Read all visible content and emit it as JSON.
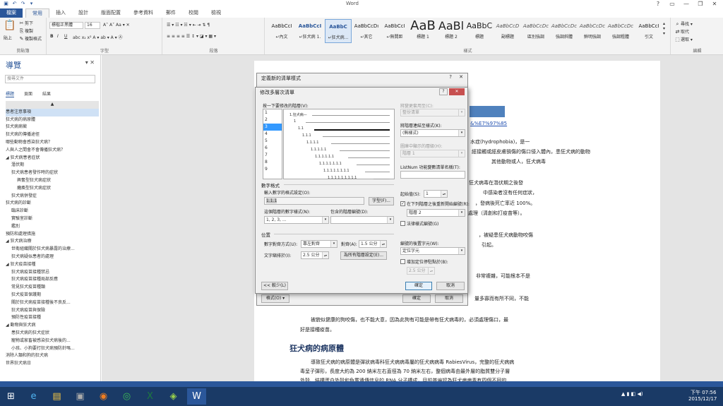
{
  "app": {
    "title": "Word",
    "qat": [
      "save-icon",
      "undo-icon",
      "redo-icon",
      "customize-icon"
    ],
    "window_controls": [
      "?",
      "▭",
      "—",
      "❐",
      "✕"
    ]
  },
  "tabs": [
    "檔案",
    "常用",
    "插入",
    "設計",
    "版面配置",
    "參考資料",
    "郵件",
    "校閱",
    "檢視"
  ],
  "ribbon": {
    "clipboard": {
      "label": "剪貼簿",
      "paste": "貼上",
      "cut": "剪下",
      "copy": "複製",
      "painter": "複製格式"
    },
    "font": {
      "label": "字型",
      "name": "標楷正黑體",
      "size": "16",
      "bold": "B",
      "italic": "I",
      "underline": "U"
    },
    "paragraph": {
      "label": "段落"
    },
    "styles": {
      "label": "樣式",
      "items": [
        {
          "sample": "AaBbCcI",
          "name": "↵內文"
        },
        {
          "sample": "AaBbCcI",
          "name": "↵狂犬病 1."
        },
        {
          "sample": "AaBbC",
          "name": "↵狂犬病..."
        },
        {
          "sample": "AaBbCcDı",
          "name": "↵其它"
        },
        {
          "sample": "AaBbCcI",
          "name": "↵無間距"
        },
        {
          "sample": "AaB",
          "name": "標題 1"
        },
        {
          "sample": "AaBl",
          "name": "標題 2"
        },
        {
          "sample": "AaBbC",
          "name": "標題"
        },
        {
          "sample": "AaBbCcD",
          "name": "副標題"
        },
        {
          "sample": "AaBbCcDc",
          "name": "區別強調"
        },
        {
          "sample": "AaBbCcDc",
          "name": "強調斜體"
        },
        {
          "sample": "AaBbCcDc",
          "name": "鮮明強調"
        },
        {
          "sample": "AaBbCcDc",
          "name": "強調粗體"
        },
        {
          "sample": "AaBbCcI",
          "name": "引文"
        }
      ]
    },
    "editing": {
      "label": "編輯",
      "find": "尋找",
      "replace": "取代",
      "select": "選取"
    }
  },
  "nav": {
    "title": "導覽",
    "search_placeholder": "搜尋文件",
    "tabs": [
      "標題",
      "頁面",
      "結果"
    ],
    "items": [
      "▲",
      "患者注意事項",
      "狂犬病的病原體",
      "狂犬病病徵",
      "狂犬病的傳播途徑",
      "哪些動物會感染狂犬病？",
      "人與人之間會不會傳播狂犬病？",
      "◢ 狂犬病患者症狀",
      "潛伏期",
      "狂犬病患者發作時的症狀",
      "興奮型狂犬病症狀",
      "癱瘓型狂犬病症狀",
      "狂犬病併發症",
      "狂犬病的診斷",
      "臨床診斷",
      "實驗室診斷",
      "鑑別",
      "預防和處理措施",
      "◢ 狂犬病治療",
      "世衛組織關於狂犬病暴露的治療...",
      "狂犬病疑似患者的處理",
      "◢ 狂犬疫苗接種",
      "狂犬病疫苗接種禁忌",
      "狂犬病疫苗接種局部反應",
      "常見狂犬疫苗種類",
      "狂犬疫苗保護期",
      "關於狂犬病疫苗接種後不良反...",
      "狂犬病疫苗與保險",
      "預防性疫苗接種",
      "◢ 動物與狂犬病",
      "患狂犬病的狂犬症狀",
      "寵物或家畜被感染狂犬病後的...",
      "小孩、小狗要打狂犬病預防針嗎...",
      "消除人類和狗的狂犬病",
      "世界狂犬病日"
    ]
  },
  "document": {
    "url": "&%E7%97%85",
    "lines": [
      {
        "t": "水症(hydrophobia)，是一"
      },
      {
        "t": "經接觸或經皮膚損傷的傷口侵入體內，患狂犬病的動物"
      },
      {
        "t": "其他動物或人，狂犬病毒"
      },
      {
        "t": "狂犬病毒在潛伏期之後發"
      },
      {
        "t": "中感染者沒有任何症狀，"
      },
      {
        "t": "，發病後死亡率近 100%。"
      },
      {
        "t": "處理（清創和打疫苗等）。"
      },
      {
        "t": "，被疑患狂犬病動物咬傷"
      },
      {
        "t": "引起。"
      },
      {
        "t": "非常複雜，可能根本不是"
      },
      {
        "t": "量多寡而有所不同，不能"
      }
    ],
    "para1": "被貌似健康的狗咬傷，也不能大意，因為此狗有可能是帶有狂犬病毒的，必須處理傷口，最",
    "para1b": "好是接種疫苗。",
    "heading": "狂犬病的病原體",
    "para2": "導致狂犬病的病原體是彈狀病毒科狂犬病病毒屬的狂犬病病毒 RabiesVirus，完整的狂犬病病",
    "para2b": "毒呈子彈形，長度大約為 200 納米左右直徑為 70 納米左右，整個病毒由最外層的脂質雙分子層",
    "para2c": "外殼、結構蛋白外殼和負載遺傳信息的 RNA 分子構成，目前普遍認為狂犬病病毒有四個不同的"
  },
  "outer_dialog": {
    "title": "定義新的清單樣式",
    "help": "?",
    "close": "✕",
    "ok": "確定",
    "cancel": "取消",
    "format": "格式(O) ▾"
  },
  "dialog": {
    "title": "修改多層次清單",
    "help": "?",
    "close": "✕",
    "level_label": "按一下要修改的階層(V):",
    "levels": [
      "1",
      "2",
      "3",
      "4",
      "5",
      "6",
      "7",
      "8",
      "9"
    ],
    "selected_level": "3",
    "preview_items": [
      "1.狂犬病—",
      "1",
      "1.1",
      "1.1.1",
      "1.1.1.1",
      "1.1.1.1.1",
      "1.1.1.1.1.1",
      "1.1.1.1.1.1.1",
      "1.1.1.1.1.1.1.1",
      "1.1.1.1.1.1.1.1.1"
    ],
    "apply_to_label": "將變更套用至(C):",
    "apply_to_value": "整份清單",
    "link_style_label": "將階層連結至樣式(K):",
    "link_style_value": "(無樣式)",
    "gallery_level_label": "圖庫中顯示的層級(H):",
    "gallery_level_value": "階層 1",
    "listnum_label": "ListNum 功能變數清單名稱(T):",
    "listnum_value": "",
    "number_format_section": "數字格式",
    "enter_format_label": "輸入數字的格式設定(O):",
    "enter_format_value": "1.1.1",
    "font_button": "字型(F)...",
    "number_style_label": "這個階層的數字樣式(N):",
    "number_style_value": "1, 2, 3, ...",
    "include_level_label": "包含的階層編號(D):",
    "include_level_value": "",
    "start_at_label": "起始值(S):",
    "start_at_value": "1",
    "restart_label": "在下列階層之後重新開始編號(R):",
    "restart_value": "階層 2",
    "legal_label": "法律樣式編號(G)",
    "position_section": "位置",
    "alignment_label": "數字對齊方式(U):",
    "alignment_value": "靠左對齊",
    "aligned_at_label": "對齊(A):",
    "aligned_at_value": "1.5 公分",
    "indent_label": "文字縮排於(I):",
    "indent_value": "2.5 公分",
    "set_all_button": "為所有階層設定(E)...",
    "follow_label": "編號的後置字元(W):",
    "follow_value": "定位字元",
    "tab_add_label": "增加定位停駐點於(B):",
    "tab_add_value": "2.5 公分",
    "less_button": "<< 較少(L)",
    "ok": "確定",
    "cancel": "取消"
  },
  "taskbar": {
    "time": "下午 07:56",
    "date": "2015/12/17"
  }
}
